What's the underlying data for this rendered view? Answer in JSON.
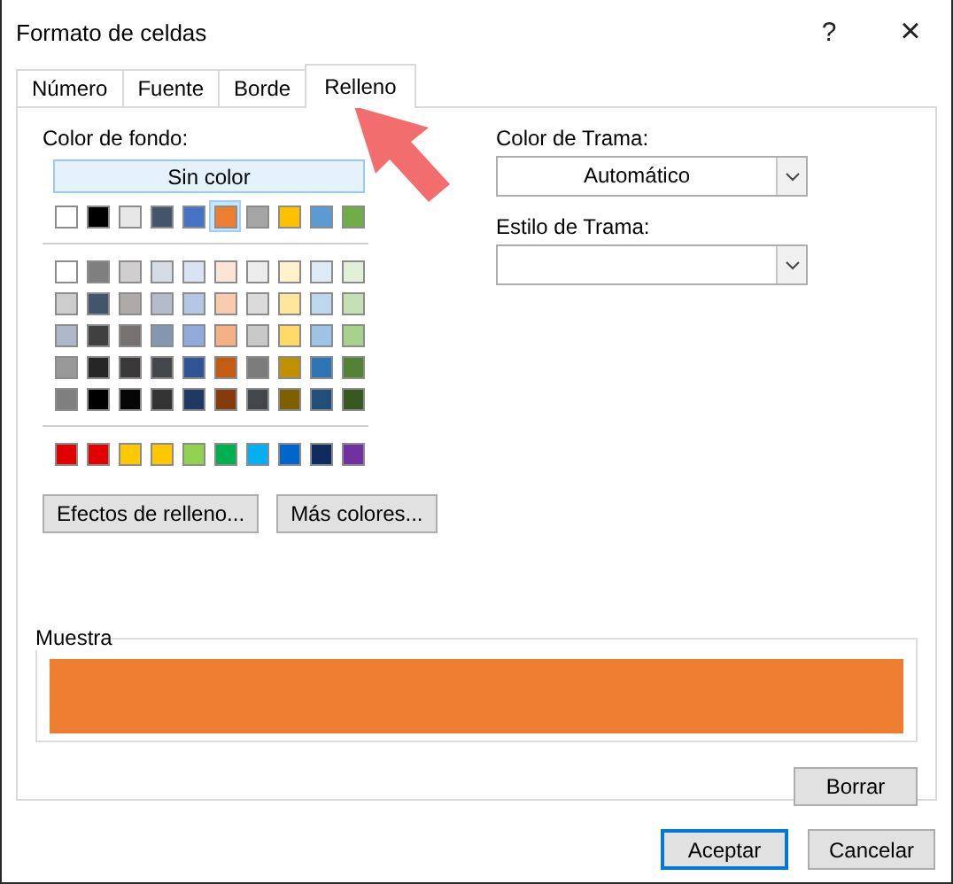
{
  "window": {
    "title": "Formato de celdas",
    "help_glyph": "?",
    "close_glyph": "×"
  },
  "tabs": [
    {
      "label": "Número",
      "selected": false
    },
    {
      "label": "Fuente",
      "selected": false
    },
    {
      "label": "Borde",
      "selected": false
    },
    {
      "label": "Relleno",
      "selected": true
    }
  ],
  "fill": {
    "label": "Color de fondo:",
    "no_color_button": "Sin color",
    "theme_top": [
      {
        "color": "#ffffff",
        "selected": false
      },
      {
        "color": "#000000",
        "selected": false
      },
      {
        "color": "#e7e6e6",
        "selected": false
      },
      {
        "color": "#44546a",
        "selected": false
      },
      {
        "color": "#4472c4",
        "selected": false
      },
      {
        "color": "#ed7d31",
        "selected": true
      },
      {
        "color": "#a5a5a5",
        "selected": false
      },
      {
        "color": "#ffc000",
        "selected": false
      },
      {
        "color": "#5b9bd5",
        "selected": false
      },
      {
        "color": "#70ad47",
        "selected": false
      }
    ],
    "theme_shades": [
      {
        "swatches": [
          {
            "color": "#ffffff",
            "selected": false
          },
          {
            "color": "#7f7f7f",
            "selected": false
          },
          {
            "color": "#d0cece",
            "selected": false
          },
          {
            "color": "#d6dce4",
            "selected": false
          },
          {
            "color": "#dae3f3",
            "selected": false
          },
          {
            "color": "#fbe5d6",
            "selected": false
          },
          {
            "color": "#ededed",
            "selected": false
          },
          {
            "color": "#fff2cc",
            "selected": false
          },
          {
            "color": "#deebf7",
            "selected": false
          },
          {
            "color": "#e2f0d9",
            "selected": false
          }
        ]
      },
      {
        "swatches": [
          {
            "color": "#cccccc",
            "selected": false
          },
          {
            "color": "#44546a",
            "selected": false
          },
          {
            "color": "#aeaaaa",
            "selected": false
          },
          {
            "color": "#b4bccc",
            "selected": false
          },
          {
            "color": "#b4c7e7",
            "selected": false
          },
          {
            "color": "#f8cbad",
            "selected": false
          },
          {
            "color": "#dbdbdb",
            "selected": false
          },
          {
            "color": "#ffe699",
            "selected": false
          },
          {
            "color": "#bdd7ee",
            "selected": false
          },
          {
            "color": "#c5e0b4",
            "selected": false
          }
        ]
      },
      {
        "swatches": [
          {
            "color": "#adb9ca",
            "selected": false
          },
          {
            "color": "#404040",
            "selected": false
          },
          {
            "color": "#757171",
            "selected": false
          },
          {
            "color": "#8497b0",
            "selected": false
          },
          {
            "color": "#8faadc",
            "selected": false
          },
          {
            "color": "#f4b183",
            "selected": false
          },
          {
            "color": "#c9c9c9",
            "selected": false
          },
          {
            "color": "#ffd966",
            "selected": false
          },
          {
            "color": "#9dc3e6",
            "selected": false
          },
          {
            "color": "#a9d18e",
            "selected": false
          }
        ]
      },
      {
        "swatches": [
          {
            "color": "#999999",
            "selected": false
          },
          {
            "color": "#262626",
            "selected": false
          },
          {
            "color": "#3a3838",
            "selected": false
          },
          {
            "color": "#44484d",
            "selected": false
          },
          {
            "color": "#2f5597",
            "selected": false
          },
          {
            "color": "#c55a11",
            "selected": false
          },
          {
            "color": "#7b7b7b",
            "selected": false
          },
          {
            "color": "#bf9000",
            "selected": false
          },
          {
            "color": "#2e75b6",
            "selected": false
          },
          {
            "color": "#548235",
            "selected": false
          }
        ]
      },
      {
        "swatches": [
          {
            "color": "#7f7f7f",
            "selected": false
          },
          {
            "color": "#000000",
            "selected": false
          },
          {
            "color": "#050505",
            "selected": false
          },
          {
            "color": "#333333",
            "selected": false
          },
          {
            "color": "#1f3864",
            "selected": false
          },
          {
            "color": "#843c0c",
            "selected": false
          },
          {
            "color": "#434649",
            "selected": false
          },
          {
            "color": "#7f6000",
            "selected": false
          },
          {
            "color": "#1f4e79",
            "selected": false
          },
          {
            "color": "#385723",
            "selected": false
          }
        ]
      }
    ],
    "standard": [
      {
        "color": "#e00000",
        "selected": false
      },
      {
        "color": "#e00000",
        "selected": false
      },
      {
        "color": "#ffc800",
        "selected": false
      },
      {
        "color": "#ffc800",
        "selected": false
      },
      {
        "color": "#92d050",
        "selected": false
      },
      {
        "color": "#00b050",
        "selected": false
      },
      {
        "color": "#00b0f0",
        "selected": false
      },
      {
        "color": "#0066cc",
        "selected": false
      },
      {
        "color": "#0f2a5f",
        "selected": false
      },
      {
        "color": "#7030a0",
        "selected": false
      }
    ],
    "buttons": [
      "Efectos de relleno...",
      "Más colores..."
    ]
  },
  "pattern_color": {
    "label": "Color de Trama:",
    "value": "Automático"
  },
  "pattern_style": {
    "label": "Estilo de Trama:"
  },
  "sample": {
    "label": "Muestra",
    "color": "#ed7d31"
  },
  "clear_button": "Borrar",
  "dialog_buttons": [
    {
      "label": "Aceptar",
      "default": true
    },
    {
      "label": "Cancelar",
      "default": false
    }
  ]
}
